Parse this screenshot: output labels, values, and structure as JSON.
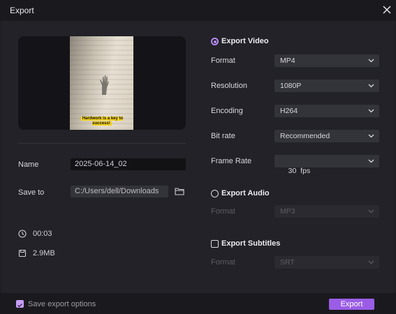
{
  "window": {
    "title": "Export"
  },
  "preview": {
    "caption": "Hardwork is a key to success!"
  },
  "left": {
    "name_label": "Name",
    "name_value": "2025-06-14_02",
    "save_label": "Save to",
    "save_value": "C:/Users/dell/Downloads",
    "duration": "00:03",
    "size": "2.9MB"
  },
  "video": {
    "section_title": "Export Video",
    "rows": [
      {
        "label": "Format",
        "value": "MP4"
      },
      {
        "label": "Resolution",
        "value": "1080P"
      },
      {
        "label": "Encoding",
        "value": "H264"
      },
      {
        "label": "Bit rate",
        "value": "Recommended"
      },
      {
        "label": "Frame Rate",
        "value": "30  fps"
      }
    ]
  },
  "audio": {
    "section_title": "Export Audio",
    "format_label": "Format",
    "format_value": "MP3"
  },
  "subtitles": {
    "section_title": "Export Subtitles",
    "format_label": "Format",
    "format_value": "SRT"
  },
  "footer": {
    "save_options_label": "Save export options",
    "export_label": "Export"
  },
  "colors": {
    "accent": "#9b5de6",
    "radio_accent": "#b48cf2",
    "background": "#1f1f24"
  }
}
